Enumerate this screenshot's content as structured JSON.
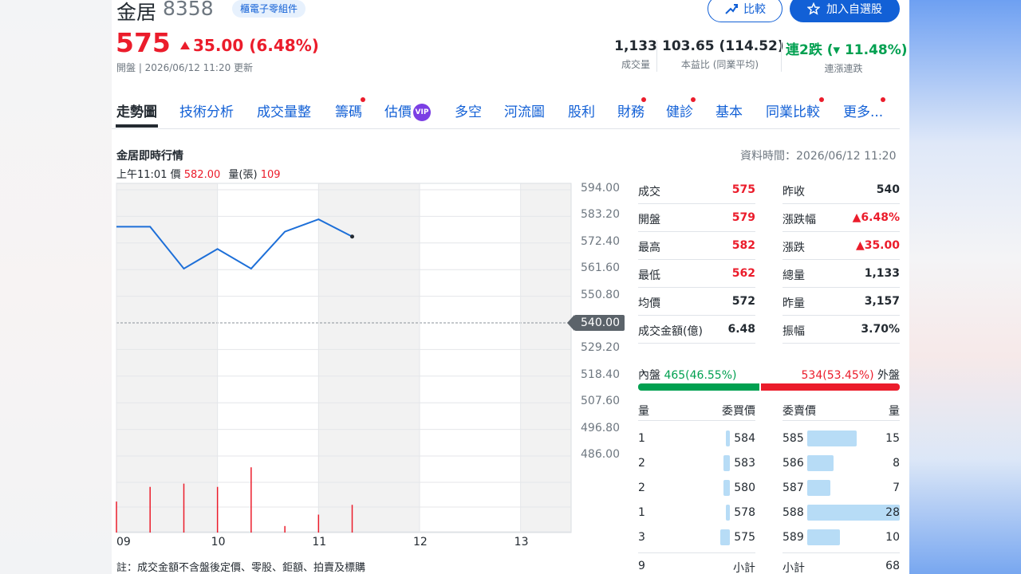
{
  "stock": {
    "name": "金居",
    "code": "8358",
    "category": "櫃電子零組件",
    "price": "575",
    "change": "35.00 (6.48%)",
    "status": "開盤 | 2026/06/12 11:20 更新"
  },
  "buttons": {
    "compare": "比較",
    "watchlist": "加入自選股"
  },
  "kpis": [
    {
      "value": "1,133",
      "label": "成交量"
    },
    {
      "value": "103.65 (114.52)",
      "label": "本益比 (同業平均)"
    },
    {
      "value": "連2跌 (▾ 11.48%)",
      "label": "連漲連跌"
    }
  ],
  "tabs": [
    "走勢圖",
    "技術分析",
    "成交量整",
    "籌碼",
    "估價",
    "多空",
    "河流圖",
    "股利",
    "財務",
    "健診",
    "基本",
    "同業比較",
    "更多..."
  ],
  "vip_label": "VIP",
  "section": {
    "title": "金居即時行情",
    "data_time": "資料時間：2026/06/12 11:20",
    "hover_time": "上午11:01",
    "hover_price_label": "價",
    "hover_price": "582.00",
    "hover_vol_label": "量(張)",
    "hover_vol": "109"
  },
  "chart_data": {
    "type": "line",
    "x_unit": "hour",
    "xlim": [
      9,
      13.5
    ],
    "ylim": [
      486,
      594
    ],
    "ref_price": 540,
    "yticks": [
      "594.00",
      "583.20",
      "572.40",
      "561.60",
      "550.80",
      "540.00",
      "529.20",
      "518.40",
      "507.60",
      "496.80",
      "486.00"
    ],
    "xticks": [
      "09",
      "10",
      "11",
      "12",
      "13"
    ],
    "price": {
      "x": [
        9.0,
        9.333,
        9.667,
        10.0,
        10.333,
        10.667,
        11.0,
        11.333
      ],
      "y": [
        579,
        579,
        562,
        570,
        562,
        577,
        582,
        575
      ]
    },
    "volume": {
      "x": [
        9.0,
        9.333,
        9.667,
        10.0,
        10.333,
        10.667,
        11.0,
        11.333
      ],
      "y": [
        95,
        140,
        150,
        140,
        200,
        20,
        55,
        85
      ]
    },
    "grid": true
  },
  "quote": {
    "left": [
      {
        "label": "成交",
        "value": "575",
        "color": "red"
      },
      {
        "label": "開盤",
        "value": "579",
        "color": "red"
      },
      {
        "label": "最高",
        "value": "582",
        "color": "red"
      },
      {
        "label": "最低",
        "value": "562",
        "color": "red"
      },
      {
        "label": "均價",
        "value": "572",
        "color": "dark"
      },
      {
        "label": "成交金額(億)",
        "value": "6.48",
        "color": "dark"
      }
    ],
    "right": [
      {
        "label": "昨收",
        "value": "540",
        "color": "dark"
      },
      {
        "label": "漲跌幅",
        "value": "▲6.48%",
        "color": "red"
      },
      {
        "label": "漲跌",
        "value": "▲35.00",
        "color": "red"
      },
      {
        "label": "總量",
        "value": "1,133",
        "color": "dark"
      },
      {
        "label": "昨量",
        "value": "3,157",
        "color": "dark"
      },
      {
        "label": "振幅",
        "value": "3.70%",
        "color": "dark"
      }
    ]
  },
  "inout": {
    "inner_label": "內盤",
    "inner_value": "465(46.55%)",
    "outer_value": "534(53.45%)",
    "outer_label": "外盤",
    "inner_fraction": 0.4655
  },
  "orderbook": {
    "headers": {
      "bid_qty": "量",
      "bid_price": "委買價",
      "ask_price": "委賣價",
      "ask_qty": "量"
    },
    "bids": [
      {
        "qty": "1",
        "price": "584",
        "level": 1
      },
      {
        "qty": "2",
        "price": "583",
        "level": 2
      },
      {
        "qty": "2",
        "price": "580",
        "level": 2
      },
      {
        "qty": "1",
        "price": "578",
        "level": 1
      },
      {
        "qty": "3",
        "price": "575",
        "level": 3
      }
    ],
    "asks": [
      {
        "price": "585",
        "qty": "15",
        "level": 15
      },
      {
        "price": "586",
        "qty": "8",
        "level": 8
      },
      {
        "price": "587",
        "qty": "7",
        "level": 7
      },
      {
        "price": "588",
        "qty": "28",
        "level": 28
      },
      {
        "price": "589",
        "qty": "10",
        "level": 10
      }
    ],
    "bid_total": "9",
    "bid_total_label": "小計",
    "ask_total_label": "小計",
    "ask_total": "68"
  },
  "footnote": "註：成交金額不含盤後定價、零股、鉅額、拍賣及標購",
  "colors": {
    "accent": "#1260d6",
    "up": "#eb1c2b",
    "down": "#00a050",
    "line": "#1d6fd8"
  }
}
